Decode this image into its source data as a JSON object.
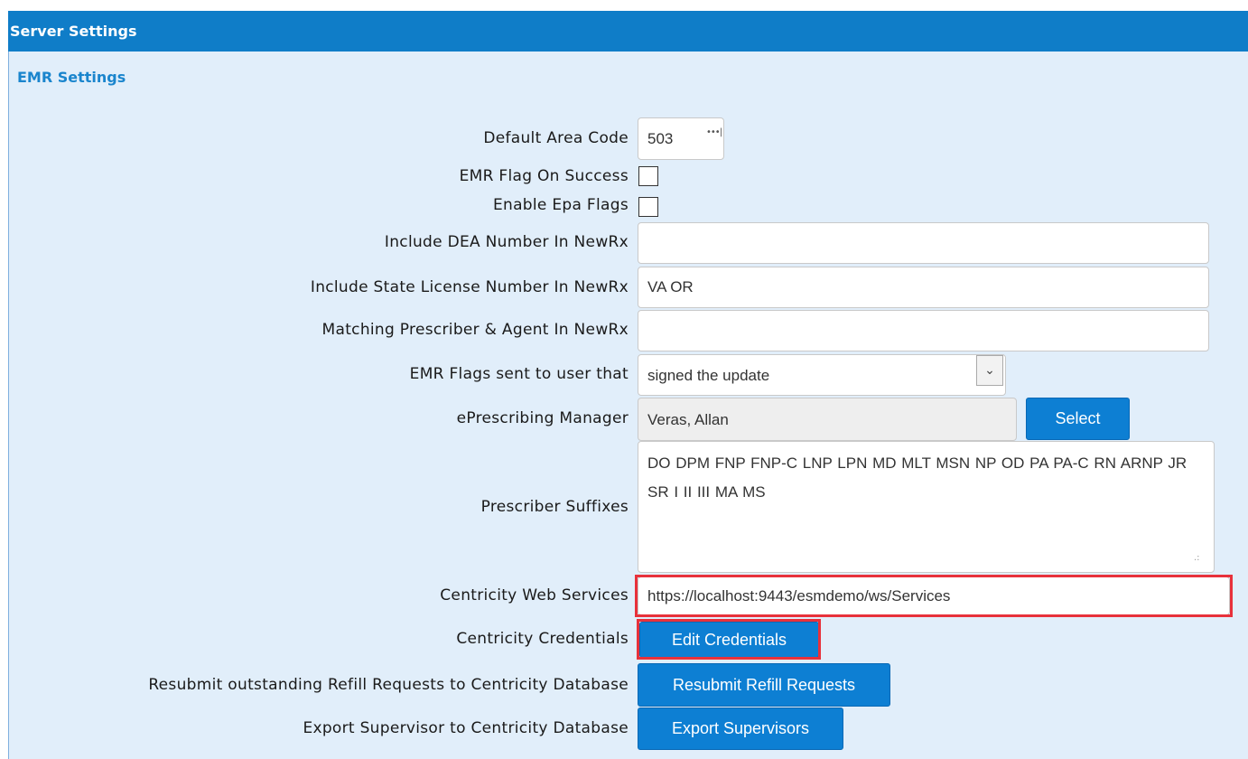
{
  "panel": {
    "header": "Server Settings"
  },
  "section": {
    "title": "EMR Settings"
  },
  "fields": {
    "default_area_code": {
      "label": "Default Area Code",
      "value": "503"
    },
    "emr_flag_on_success": {
      "label": "EMR Flag On Success",
      "checked": false
    },
    "enable_epa_flags": {
      "label": "Enable Epa Flags",
      "checked": false
    },
    "include_dea": {
      "label": "Include DEA Number In NewRx",
      "value": ""
    },
    "include_state_license": {
      "label": "Include State License Number In NewRx",
      "value": "VA OR"
    },
    "matching_prescriber": {
      "label": "Matching Prescriber & Agent In NewRx",
      "value": ""
    },
    "emr_flags_sent": {
      "label": "EMR Flags sent to user that",
      "value": "signed the update"
    },
    "eprescribing_manager": {
      "label": "ePrescribing Manager",
      "value": "Veras, Allan",
      "button": "Select"
    },
    "prescriber_suffixes": {
      "label": "Prescriber Suffixes",
      "value": "DO DPM FNP FNP-C LNP LPN MD MLT MSN NP OD PA PA-C RN ARNP JR SR I II III MA MS"
    },
    "centricity_web_services": {
      "label": "Centricity Web Services",
      "value": "https://localhost:9443/esmdemo/ws/Services"
    },
    "centricity_credentials": {
      "label": "Centricity Credentials",
      "button": "Edit Credentials"
    },
    "resubmit_refill": {
      "label": "Resubmit outstanding Refill Requests to Centricity Database",
      "button": "Resubmit Refill Requests"
    },
    "export_supervisor": {
      "label": "Export Supervisor to Centricity Database",
      "button": "Export Supervisors"
    }
  },
  "colors": {
    "header_bg": "#0f7dc8",
    "panel_bg": "#e1eefa",
    "button_bg": "#0d7fd3",
    "highlight": "#e8313b",
    "section_title": "#1a85cd"
  }
}
